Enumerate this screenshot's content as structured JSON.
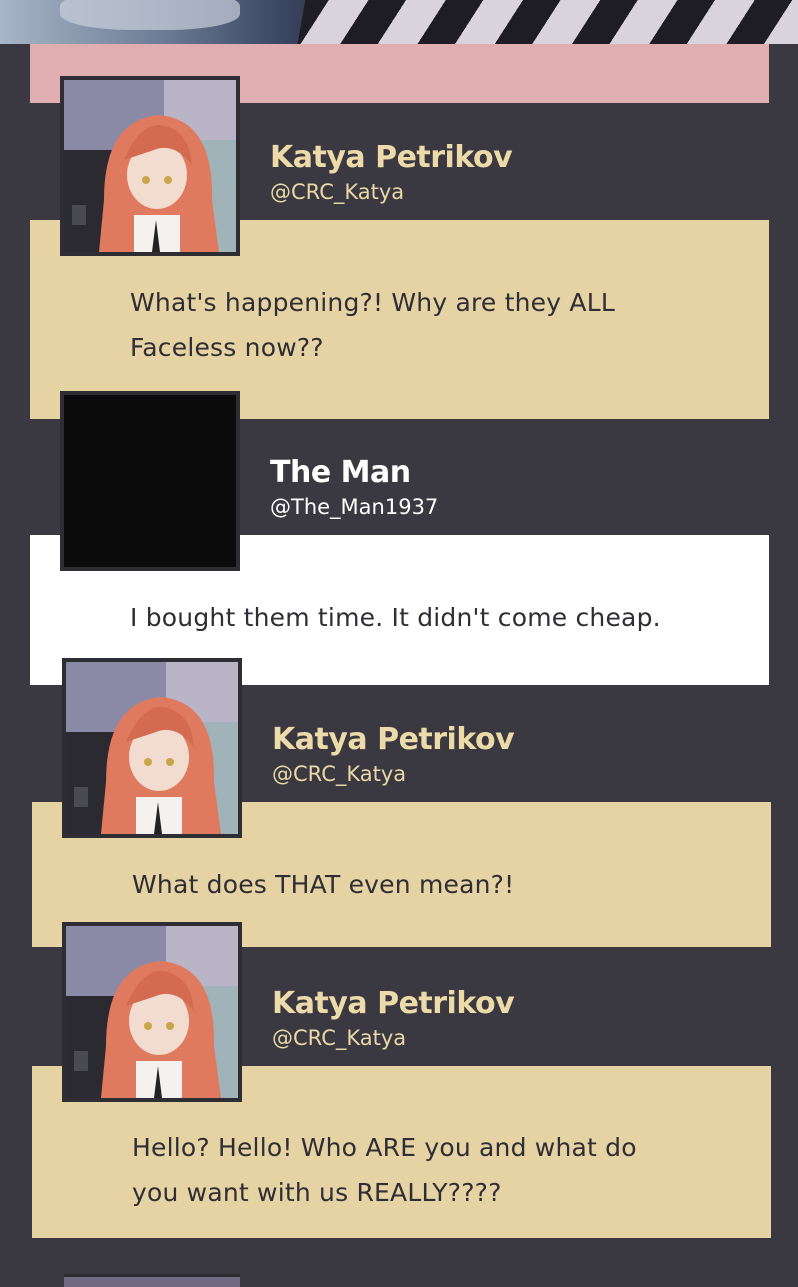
{
  "posts": [
    {
      "name": "Katya Petrikov",
      "handle": "@CRC_Katya",
      "text": "What's happening?! Why are they ALL Faceless now??"
    },
    {
      "name": "The Man",
      "handle": "@The_Man1937",
      "text": "I bought them time. It didn't come cheap."
    },
    {
      "name": "Katya Petrikov",
      "handle": "@CRC_Katya",
      "text": "What does THAT even mean?!"
    },
    {
      "name": "Katya Petrikov",
      "handle": "@CRC_Katya",
      "text": "Hello? Hello! Who ARE you and what do you want with us REALLY????"
    }
  ],
  "colors": {
    "background": "#3a3941",
    "cream_bubble": "#e5d3a3",
    "white_bubble": "#ffffff",
    "pink_strip": "#e0aeb0",
    "name_cream": "#ecdba8"
  }
}
